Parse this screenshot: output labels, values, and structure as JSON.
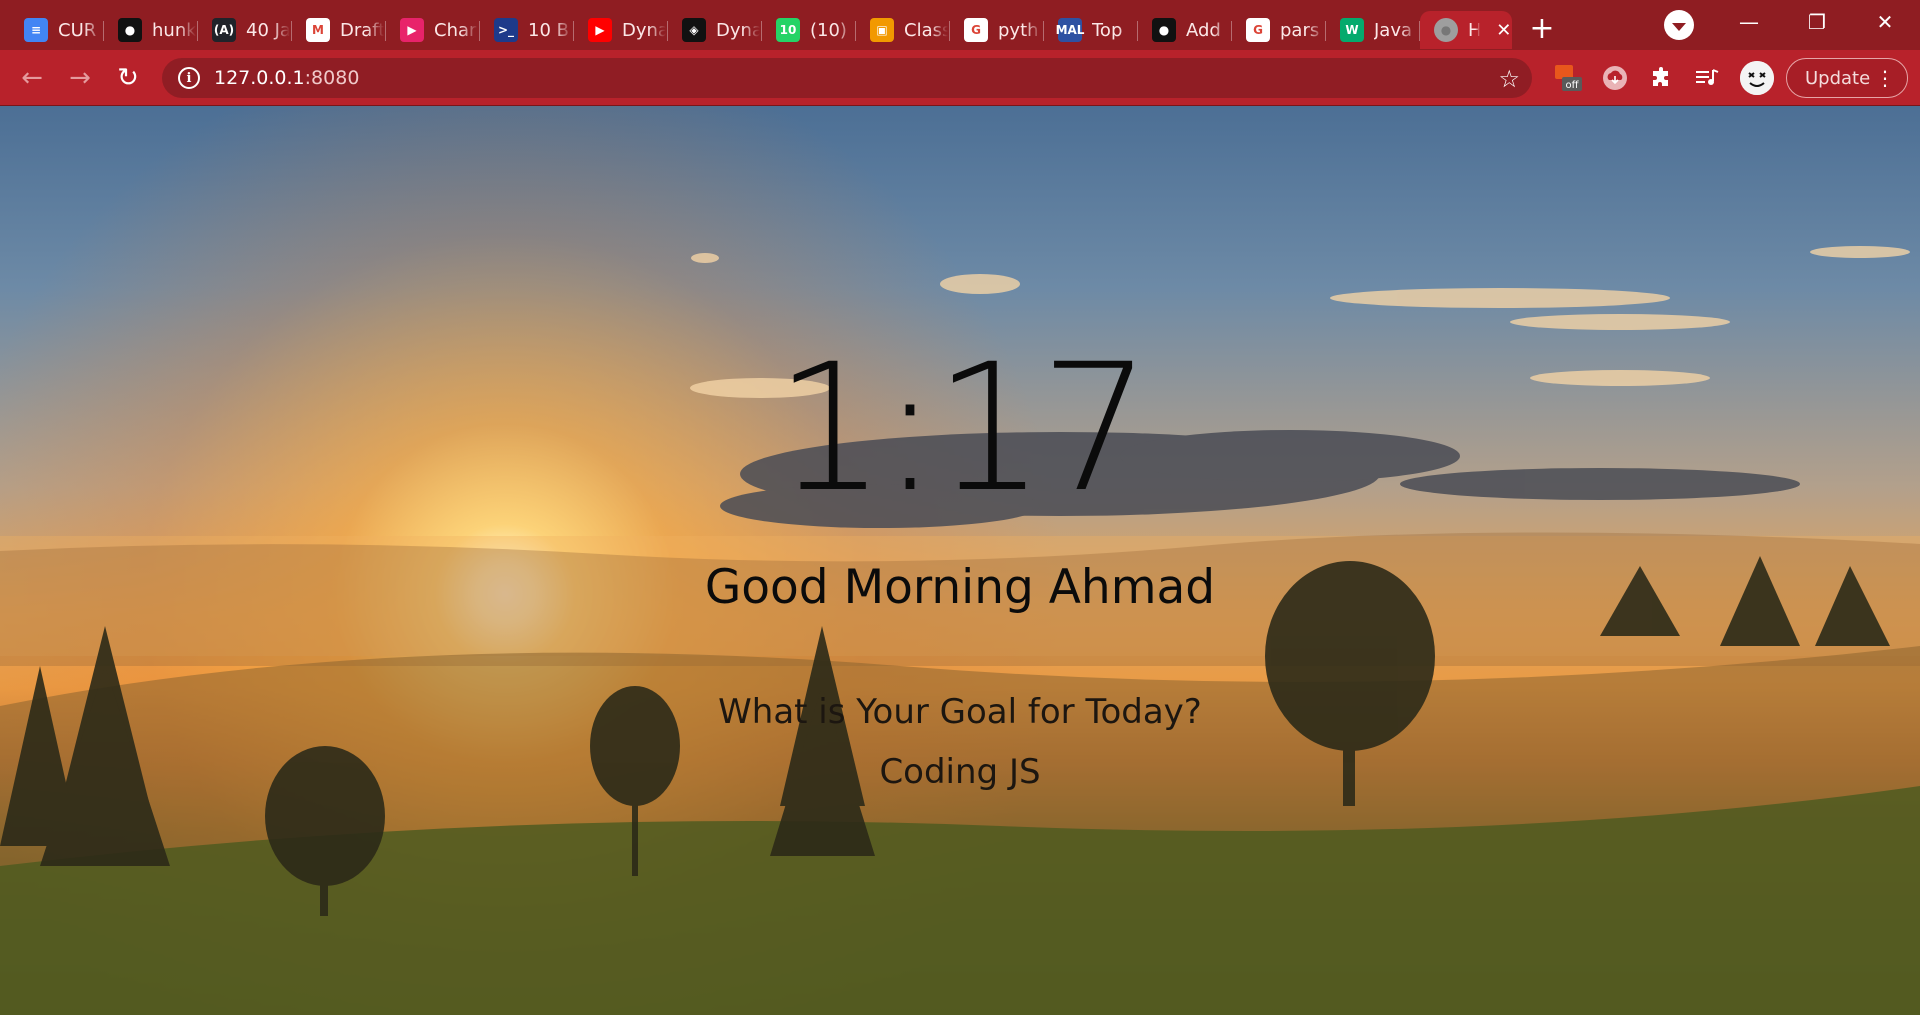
{
  "browser": {
    "tabs": [
      {
        "title": "CUR",
        "icon": "google-docs-icon",
        "color": "#4285f4",
        "glyph": "≡"
      },
      {
        "title": "hunk",
        "icon": "github-icon",
        "color": "#111111",
        "glyph": "●"
      },
      {
        "title": "40 Ja",
        "icon": "react-dev-icon",
        "color": "#20232a",
        "glyph": "(A)"
      },
      {
        "title": "Draft",
        "icon": "gmail-icon",
        "color": "#ffffff",
        "glyph": "M"
      },
      {
        "title": "Char",
        "icon": "chat-app-icon",
        "color": "#e8236a",
        "glyph": "▶"
      },
      {
        "title": "10 B",
        "icon": "terminal-icon",
        "color": "#1e3a8a",
        "glyph": ">_"
      },
      {
        "title": "Dyna",
        "icon": "youtube-icon",
        "color": "#ff0000",
        "glyph": "▶"
      },
      {
        "title": "Dyna",
        "icon": "codepen-icon",
        "color": "#111111",
        "glyph": "◈"
      },
      {
        "title": "(10)",
        "icon": "whatsapp-icon",
        "color": "#25d366",
        "glyph": "10"
      },
      {
        "title": "Class",
        "icon": "google-classroom-icon",
        "color": "#f29900",
        "glyph": "▣"
      },
      {
        "title": "pyth",
        "icon": "google-icon",
        "color": "#ffffff",
        "glyph": "G"
      },
      {
        "title": "Top",
        "icon": "myanimelist-icon",
        "color": "#2e51a2",
        "glyph": "MAL"
      },
      {
        "title": "Add",
        "icon": "github-icon",
        "color": "#111111",
        "glyph": "●"
      },
      {
        "title": "pars",
        "icon": "google-icon",
        "color": "#ffffff",
        "glyph": "G"
      },
      {
        "title": "Java",
        "icon": "w3schools-icon",
        "color": "#04aa6d",
        "glyph": "W"
      },
      {
        "title": "H",
        "icon": "globe-icon",
        "color": "#9e9e9e",
        "glyph": "●",
        "active": true
      }
    ],
    "close_tab": "✕",
    "new_tab": "+",
    "window": {
      "minimize": "—",
      "restore": "❐",
      "close": "✕"
    },
    "address": {
      "host": "127.0.0.1",
      "port": ":8080"
    },
    "extensions": [
      {
        "name": "pdf-off-extension-icon",
        "glyph": "off"
      },
      {
        "name": "cloud-download-extension-icon",
        "glyph": "☁"
      },
      {
        "name": "puzzle-extensions-icon",
        "glyph": "✚"
      },
      {
        "name": "media-playlist-icon",
        "glyph": "≡"
      }
    ],
    "update_label": "Update",
    "colors": {
      "frame": "#8f1d22",
      "toolbar": "#b8222b",
      "omnibox": "#901d24"
    }
  },
  "page": {
    "time": "1:17",
    "greeting": "Good Morning Ahmad",
    "focus_question": "What is Your Goal for Today?",
    "focus_value": "Coding JS"
  }
}
